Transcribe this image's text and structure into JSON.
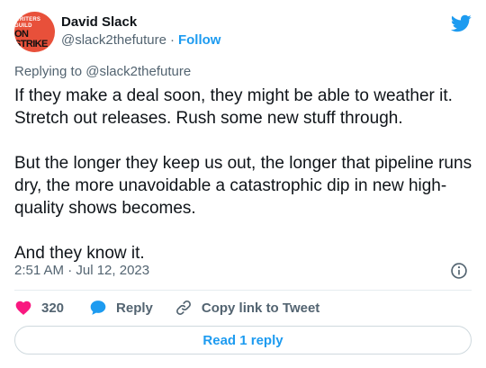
{
  "author": {
    "name": "David Slack",
    "handle": "@slack2thefuture",
    "separator": "·",
    "follow_label": "Follow",
    "avatar_line1": "WRITERS GUILD",
    "avatar_line2": "ON STRIKE"
  },
  "reply_context": {
    "prefix": "Replying to ",
    "mention": "@slack2thefuture"
  },
  "tweet": {
    "paragraphs": [
      "If they make a deal soon, they might be able to weather it. Stretch out releases. Rush some new stuff through.",
      "But the longer they keep us out, the longer that pipeline runs dry, the more unavoidable a catastrophic dip in new high-quality shows becomes.",
      "And they know it."
    ],
    "timestamp": "2:51 AM · Jul 12, 2023"
  },
  "actions": {
    "like_count": "320",
    "reply_label": "Reply",
    "copy_label": "Copy link to Tweet"
  },
  "read_replies_label": "Read 1 reply",
  "colors": {
    "accent": "#1d9bf0",
    "like": "#f91880",
    "secondary_text": "#536471",
    "avatar_bg": "#e8503a"
  },
  "icons": {
    "brand": "twitter-bird-icon",
    "info": "info-icon",
    "like": "heart-icon",
    "reply": "speech-bubble-icon",
    "copy": "link-icon"
  }
}
